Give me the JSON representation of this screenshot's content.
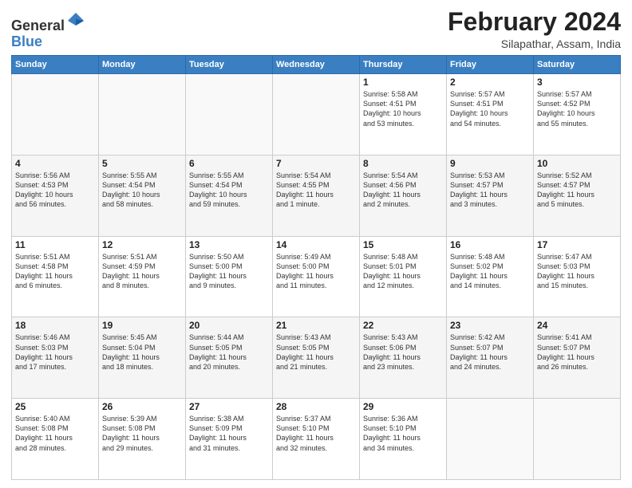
{
  "header": {
    "logo": {
      "general": "General",
      "blue": "Blue"
    },
    "title": "February 2024",
    "location": "Silapathar, Assam, India"
  },
  "calendar": {
    "days_of_week": [
      "Sunday",
      "Monday",
      "Tuesday",
      "Wednesday",
      "Thursday",
      "Friday",
      "Saturday"
    ],
    "weeks": [
      [
        {
          "day": "",
          "info": ""
        },
        {
          "day": "",
          "info": ""
        },
        {
          "day": "",
          "info": ""
        },
        {
          "day": "",
          "info": ""
        },
        {
          "day": "1",
          "info": "Sunrise: 5:58 AM\nSunset: 4:51 PM\nDaylight: 10 hours\nand 53 minutes."
        },
        {
          "day": "2",
          "info": "Sunrise: 5:57 AM\nSunset: 4:51 PM\nDaylight: 10 hours\nand 54 minutes."
        },
        {
          "day": "3",
          "info": "Sunrise: 5:57 AM\nSunset: 4:52 PM\nDaylight: 10 hours\nand 55 minutes."
        }
      ],
      [
        {
          "day": "4",
          "info": "Sunrise: 5:56 AM\nSunset: 4:53 PM\nDaylight: 10 hours\nand 56 minutes."
        },
        {
          "day": "5",
          "info": "Sunrise: 5:55 AM\nSunset: 4:54 PM\nDaylight: 10 hours\nand 58 minutes."
        },
        {
          "day": "6",
          "info": "Sunrise: 5:55 AM\nSunset: 4:54 PM\nDaylight: 10 hours\nand 59 minutes."
        },
        {
          "day": "7",
          "info": "Sunrise: 5:54 AM\nSunset: 4:55 PM\nDaylight: 11 hours\nand 1 minute."
        },
        {
          "day": "8",
          "info": "Sunrise: 5:54 AM\nSunset: 4:56 PM\nDaylight: 11 hours\nand 2 minutes."
        },
        {
          "day": "9",
          "info": "Sunrise: 5:53 AM\nSunset: 4:57 PM\nDaylight: 11 hours\nand 3 minutes."
        },
        {
          "day": "10",
          "info": "Sunrise: 5:52 AM\nSunset: 4:57 PM\nDaylight: 11 hours\nand 5 minutes."
        }
      ],
      [
        {
          "day": "11",
          "info": "Sunrise: 5:51 AM\nSunset: 4:58 PM\nDaylight: 11 hours\nand 6 minutes."
        },
        {
          "day": "12",
          "info": "Sunrise: 5:51 AM\nSunset: 4:59 PM\nDaylight: 11 hours\nand 8 minutes."
        },
        {
          "day": "13",
          "info": "Sunrise: 5:50 AM\nSunset: 5:00 PM\nDaylight: 11 hours\nand 9 minutes."
        },
        {
          "day": "14",
          "info": "Sunrise: 5:49 AM\nSunset: 5:00 PM\nDaylight: 11 hours\nand 11 minutes."
        },
        {
          "day": "15",
          "info": "Sunrise: 5:48 AM\nSunset: 5:01 PM\nDaylight: 11 hours\nand 12 minutes."
        },
        {
          "day": "16",
          "info": "Sunrise: 5:48 AM\nSunset: 5:02 PM\nDaylight: 11 hours\nand 14 minutes."
        },
        {
          "day": "17",
          "info": "Sunrise: 5:47 AM\nSunset: 5:03 PM\nDaylight: 11 hours\nand 15 minutes."
        }
      ],
      [
        {
          "day": "18",
          "info": "Sunrise: 5:46 AM\nSunset: 5:03 PM\nDaylight: 11 hours\nand 17 minutes."
        },
        {
          "day": "19",
          "info": "Sunrise: 5:45 AM\nSunset: 5:04 PM\nDaylight: 11 hours\nand 18 minutes."
        },
        {
          "day": "20",
          "info": "Sunrise: 5:44 AM\nSunset: 5:05 PM\nDaylight: 11 hours\nand 20 minutes."
        },
        {
          "day": "21",
          "info": "Sunrise: 5:43 AM\nSunset: 5:05 PM\nDaylight: 11 hours\nand 21 minutes."
        },
        {
          "day": "22",
          "info": "Sunrise: 5:43 AM\nSunset: 5:06 PM\nDaylight: 11 hours\nand 23 minutes."
        },
        {
          "day": "23",
          "info": "Sunrise: 5:42 AM\nSunset: 5:07 PM\nDaylight: 11 hours\nand 24 minutes."
        },
        {
          "day": "24",
          "info": "Sunrise: 5:41 AM\nSunset: 5:07 PM\nDaylight: 11 hours\nand 26 minutes."
        }
      ],
      [
        {
          "day": "25",
          "info": "Sunrise: 5:40 AM\nSunset: 5:08 PM\nDaylight: 11 hours\nand 28 minutes."
        },
        {
          "day": "26",
          "info": "Sunrise: 5:39 AM\nSunset: 5:08 PM\nDaylight: 11 hours\nand 29 minutes."
        },
        {
          "day": "27",
          "info": "Sunrise: 5:38 AM\nSunset: 5:09 PM\nDaylight: 11 hours\nand 31 minutes."
        },
        {
          "day": "28",
          "info": "Sunrise: 5:37 AM\nSunset: 5:10 PM\nDaylight: 11 hours\nand 32 minutes."
        },
        {
          "day": "29",
          "info": "Sunrise: 5:36 AM\nSunset: 5:10 PM\nDaylight: 11 hours\nand 34 minutes."
        },
        {
          "day": "",
          "info": ""
        },
        {
          "day": "",
          "info": ""
        }
      ]
    ]
  }
}
